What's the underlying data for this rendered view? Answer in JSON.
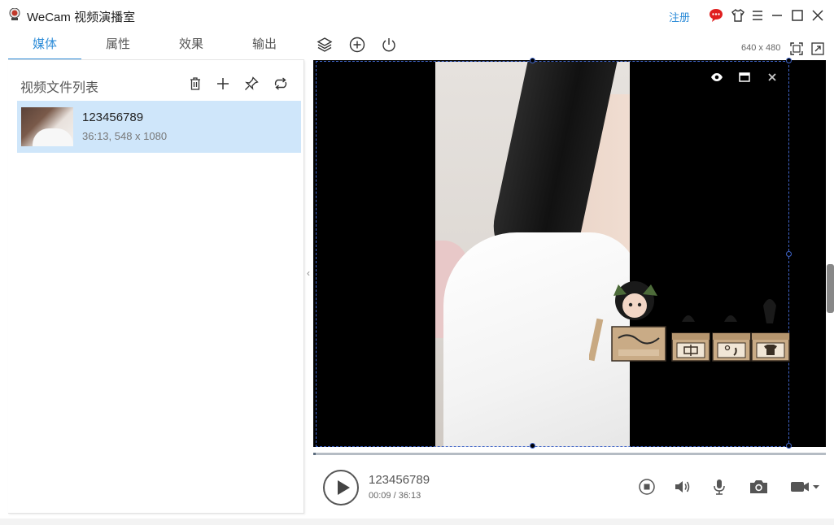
{
  "window": {
    "title": "WeCam 视频演播室",
    "register_label": "注册"
  },
  "tabs": [
    "媒体",
    "属性",
    "效果",
    "输出"
  ],
  "active_tab": 0,
  "preview_resolution": "640 x 480",
  "media_panel": {
    "header": "视频文件列表",
    "items": [
      {
        "name": "123456789",
        "meta": "36:13, 548 x 1080"
      }
    ]
  },
  "player": {
    "title": "123456789",
    "time": "00:09 / 36:13",
    "progress": 0.004
  },
  "colors": {
    "accent": "#2d8cd8",
    "selected_row": "#cfe6fa",
    "selection_border": "#3f64c8",
    "message_icon": "#e02020"
  }
}
